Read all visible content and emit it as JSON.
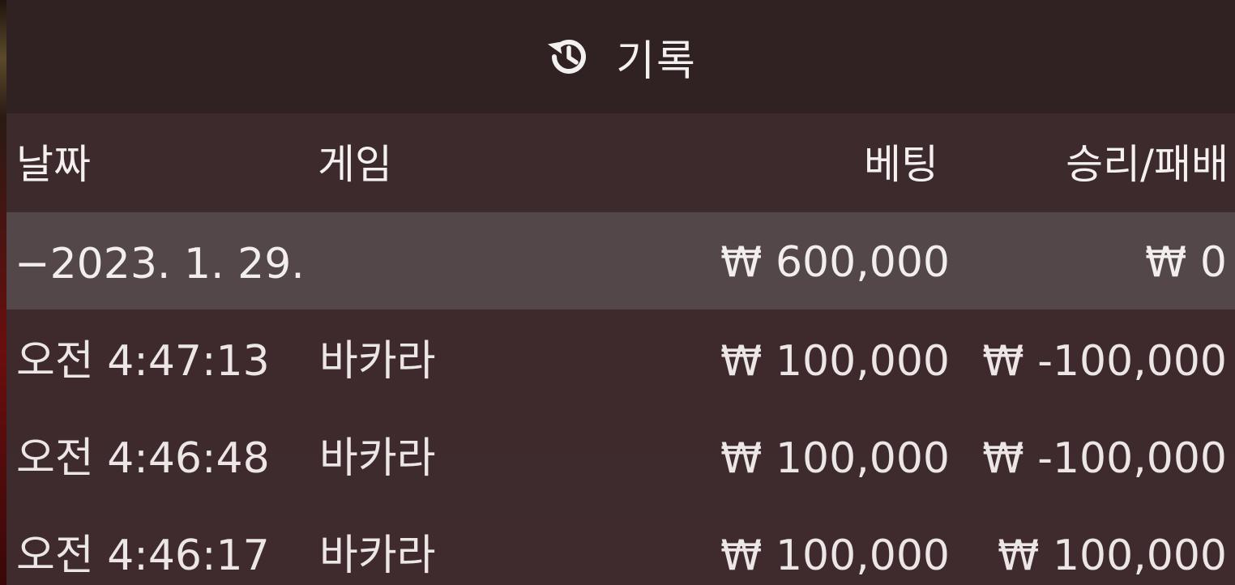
{
  "header": {
    "icon": "history-icon",
    "title": "기록"
  },
  "columns": {
    "date": "날짜",
    "game": "게임",
    "bet": "베팅",
    "win_loss": "승리/패배"
  },
  "summary": {
    "date": "−2023. 1. 29.",
    "game": "",
    "bet": "₩ 600,000",
    "win_loss": "₩ 0"
  },
  "rows": [
    {
      "time": "오전 4:47:13",
      "game": "바카라",
      "bet": "₩ 100,000",
      "win_loss": "₩ -100,000"
    },
    {
      "time": "오전 4:46:48",
      "game": "바카라",
      "bet": "₩ 100,000",
      "win_loss": "₩ -100,000"
    },
    {
      "time": "오전 4:46:17",
      "game": "바카라",
      "bet": "₩ 100,000",
      "win_loss": "₩ 100,000"
    }
  ],
  "colors": {
    "background": "#3d2a2c",
    "header": "#302123",
    "summary_row": "#544749",
    "text": "#f2eeee"
  }
}
